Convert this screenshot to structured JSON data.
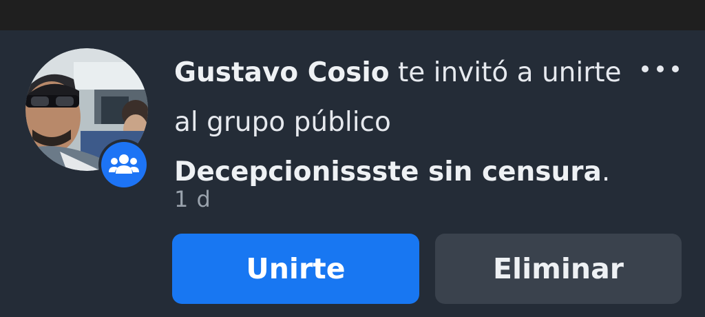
{
  "notification": {
    "sender_name": "Gustavo Cosio",
    "message_part1": " te invitó a unirte",
    "message_part2": "al grupo público",
    "group_name": "Decepcionissste sin censura",
    "group_name_suffix": ".",
    "time": "1 d"
  },
  "actions": {
    "join_label": "Unirte",
    "delete_label": "Eliminar"
  },
  "icons": {
    "more": "more-options-icon",
    "badge": "group-icon"
  },
  "colors": {
    "background": "#242c37",
    "primary_button": "#1877f2",
    "secondary_button": "#3a424d",
    "badge": "#1d74f5"
  }
}
